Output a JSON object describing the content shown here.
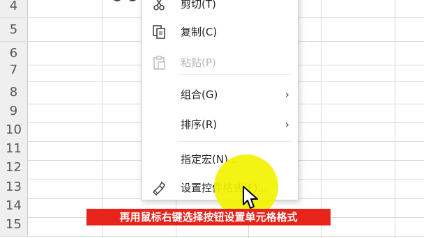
{
  "spreadsheet": {
    "row_numbers": [
      "4",
      "5",
      "6",
      "7",
      "8",
      "9",
      "10",
      "11",
      "12",
      "13",
      "14",
      "15"
    ]
  },
  "context_menu": {
    "items": [
      {
        "label": "剪切(T)",
        "icon": "scissors-icon",
        "enabled": true
      },
      {
        "label": "复制(C)",
        "icon": "copy-icon",
        "enabled": true
      },
      {
        "label": "粘贴(P)",
        "icon": "paste-icon",
        "enabled": false
      },
      {
        "label": "组合(G)",
        "icon": "",
        "enabled": true,
        "submenu": true
      },
      {
        "label": "排序(R)",
        "icon": "",
        "enabled": true,
        "submenu": true
      },
      {
        "label": "指定宏(N)...",
        "icon": "",
        "enabled": true
      },
      {
        "label": "设置控件格式(F)...",
        "icon": "format-control-icon",
        "enabled": true
      }
    ],
    "submenu_arrow": "›"
  },
  "caption": {
    "text": "再用鼠标右键选择按钮设置单元格格式",
    "background": "#e8231a",
    "color": "#ffffff"
  },
  "highlight_color": "#f2f200"
}
